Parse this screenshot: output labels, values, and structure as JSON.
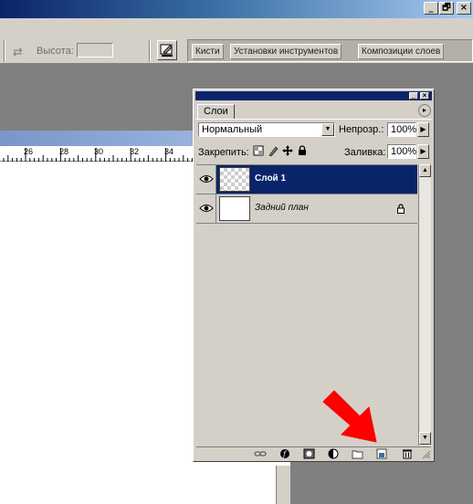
{
  "colors": {
    "selection": "#0a246a",
    "chrome": "#d4d0c8",
    "workspace": "#808080",
    "arrow": "#ff0000"
  },
  "window": {
    "controls": [
      "_",
      "🗗",
      "×"
    ]
  },
  "options_bar": {
    "height_label": "Высота:",
    "height_value": "",
    "palette_well_tabs": [
      "Кисти",
      "Установки инструментов",
      "Композиции слоев"
    ]
  },
  "document": {
    "ruler_labels": [
      "26",
      "28",
      "30",
      "32",
      "34"
    ]
  },
  "layers_palette": {
    "tab_label": "Слои",
    "blend_mode": "Нормальный",
    "opacity_label": "Непрозр.:",
    "opacity_value": "100%",
    "lock_label": "Закрепить:",
    "fill_label": "Заливка:",
    "fill_value": "100%",
    "layers": [
      {
        "name": "Слой 1",
        "visible": true,
        "selected": true,
        "locked": false
      },
      {
        "name": "Задний план",
        "visible": true,
        "selected": false,
        "locked": true
      }
    ],
    "footer_icons": [
      "link-icon",
      "layer-style-icon",
      "layer-mask-icon",
      "adjustment-layer-icon",
      "new-group-icon",
      "new-layer-icon",
      "trash-icon"
    ]
  },
  "annotation": {
    "arrow_target": "new-layer-icon"
  }
}
